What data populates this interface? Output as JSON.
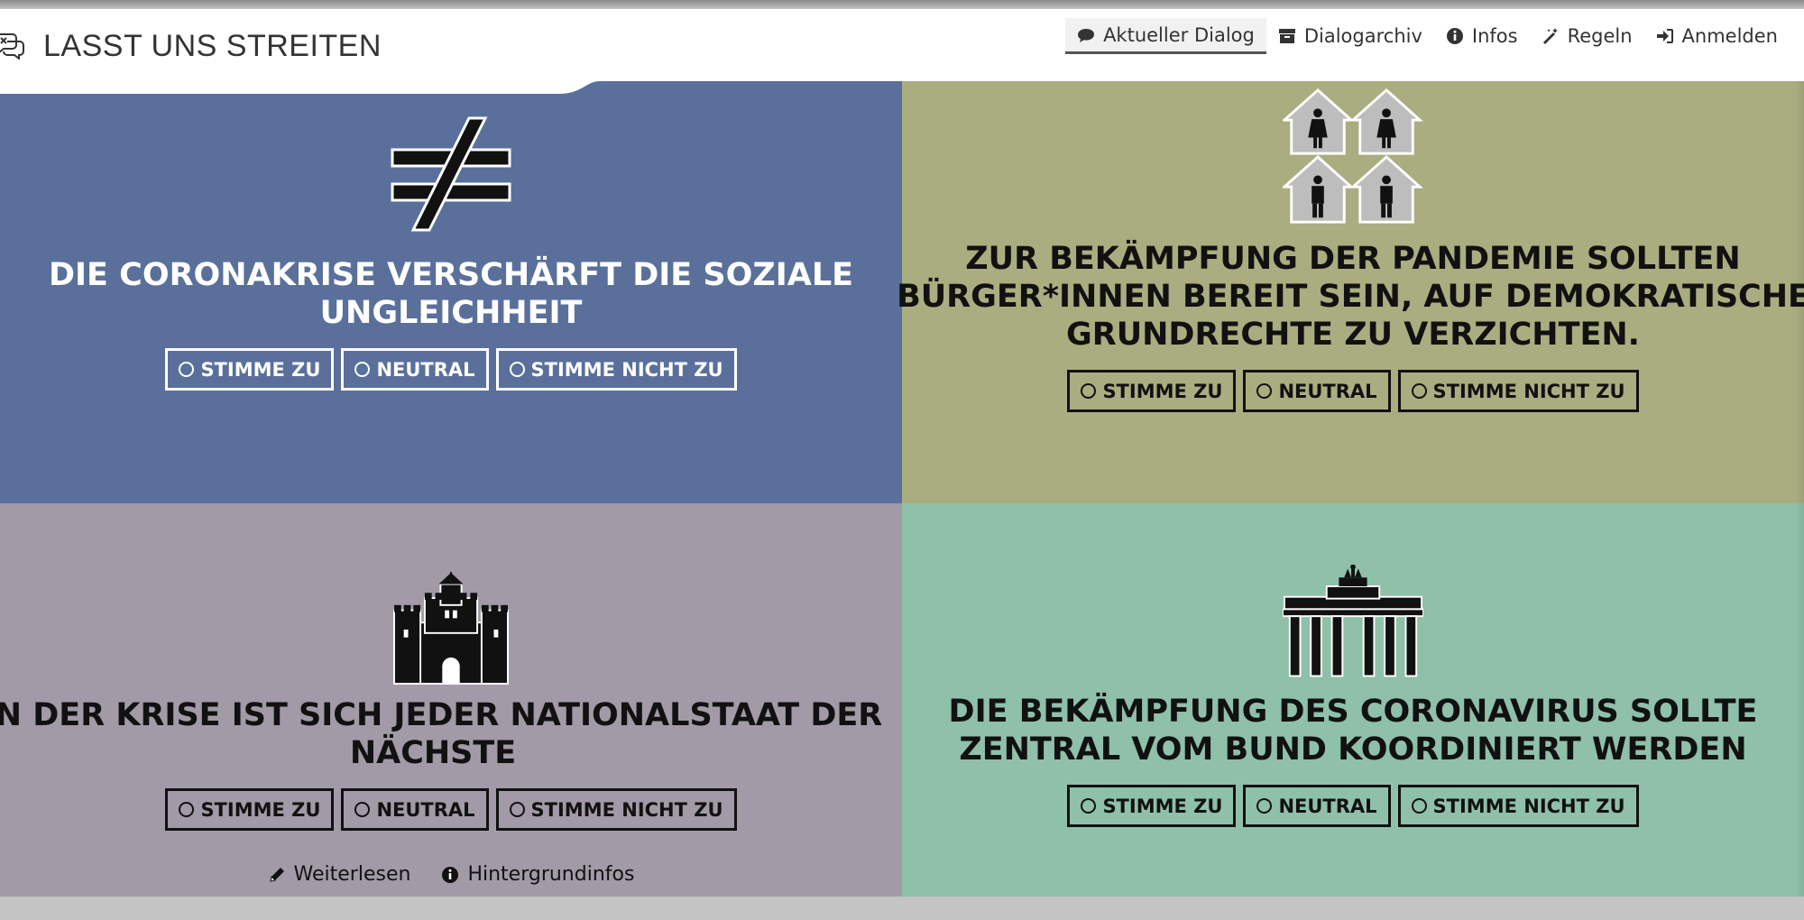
{
  "app": {
    "title": "LASST UNS STREITEN"
  },
  "nav": [
    {
      "label": "Aktueller Dialog",
      "icon": "comment-icon",
      "active": true
    },
    {
      "label": "Dialogarchiv",
      "icon": "archive-icon",
      "active": false
    },
    {
      "label": "Infos",
      "icon": "info-icon",
      "active": false
    },
    {
      "label": "Regeln",
      "icon": "magic-wand-icon",
      "active": false
    },
    {
      "label": "Anmelden",
      "icon": "sign-in-icon",
      "active": false
    }
  ],
  "theses": [
    {
      "icon": "not-equal-icon",
      "title_lines": [
        "DIE CORONAKRISE VERSCHÄRFT DIE SOZIALE",
        "UNGLEICHHEIT"
      ],
      "color": "#5a709b"
    },
    {
      "icon": "houses-people-icon",
      "title_lines": [
        "ZUR BEKÄMPFUNG DER PANDEMIE SOLLTEN",
        "BÜRGER*INNEN BEREIT SEIN, AUF DEMOKRATISCHE",
        "GRUNDRECHTE ZU VERZICHTEN."
      ],
      "color": "#a9ad80"
    },
    {
      "icon": "castle-icon",
      "title_lines": [
        "IN DER KRISE IST SICH JEDER NATIONALSTAAT DER",
        "NÄCHSTE"
      ],
      "color": "#a29aa7"
    },
    {
      "icon": "brandenburg-gate-icon",
      "title_lines": [
        "DIE BEKÄMPFUNG DES CORONAVIRUS SOLLTE",
        "ZENTRAL VOM BUND KOORDINIERT WERDEN"
      ],
      "color": "#8fc0a9"
    }
  ],
  "vote": {
    "agree": "STIMME ZU",
    "neutral": "NEUTRAL",
    "disagree": "STIMME NICHT ZU"
  },
  "links": {
    "read_more": "Weiterlesen",
    "background": "Hintergrundinfos"
  }
}
